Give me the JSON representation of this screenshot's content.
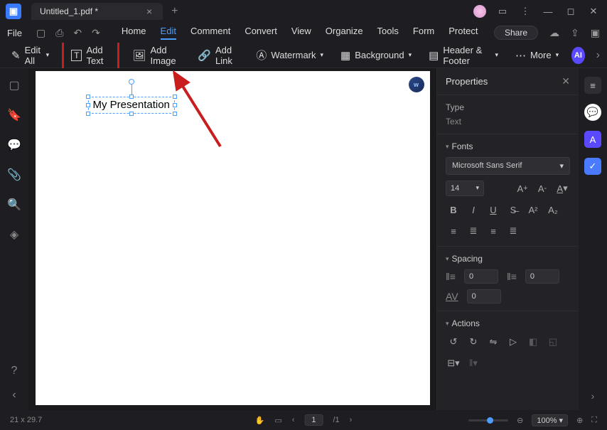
{
  "titlebar": {
    "tab_name": "Untitled_1.pdf *"
  },
  "menubar": {
    "file": "File",
    "items": [
      "Home",
      "Edit",
      "Comment",
      "Convert",
      "View",
      "Organize",
      "Tools",
      "Form",
      "Protect"
    ],
    "active_index": 1,
    "share": "Share"
  },
  "toolbar": {
    "edit_all": "Edit All",
    "add_text": "Add Text",
    "add_image": "Add Image",
    "add_link": "Add Link",
    "watermark": "Watermark",
    "background": "Background",
    "header_footer": "Header & Footer",
    "more": "More",
    "ai": "AI"
  },
  "canvas": {
    "text_content": "My Presentation",
    "badge": "w"
  },
  "properties": {
    "title": "Properties",
    "type_label": "Type",
    "type_value": "Text",
    "fonts_label": "Fonts",
    "font_family": "Microsoft Sans Serif",
    "font_size": "14",
    "spacing_label": "Spacing",
    "line_spacing": "0",
    "para_spacing": "0",
    "char_spacing": "0",
    "actions_label": "Actions"
  },
  "statusbar": {
    "dimensions": "21 x 29.7",
    "page_current": "1",
    "page_total": "/1",
    "zoom": "100%"
  }
}
